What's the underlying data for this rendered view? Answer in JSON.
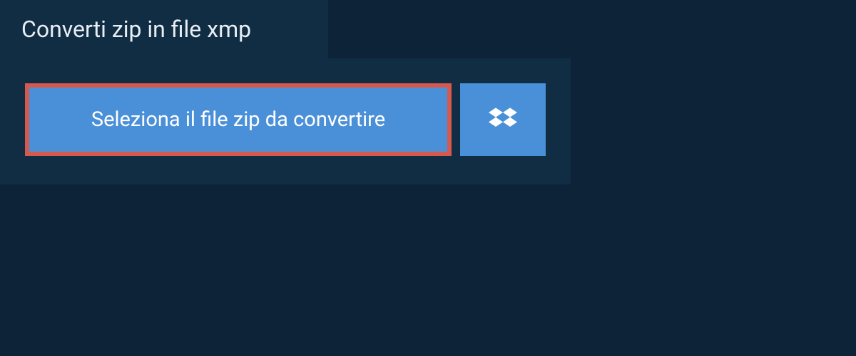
{
  "header": {
    "title": "Converti zip in file xmp"
  },
  "actions": {
    "select_file_label": "Seleziona il file zip da convertire"
  },
  "colors": {
    "background": "#0d2438",
    "panel": "#112d44",
    "button": "#4a90d9",
    "highlight_border": "#d45a4f",
    "text_light": "#e8eef3",
    "text_white": "#ffffff"
  }
}
